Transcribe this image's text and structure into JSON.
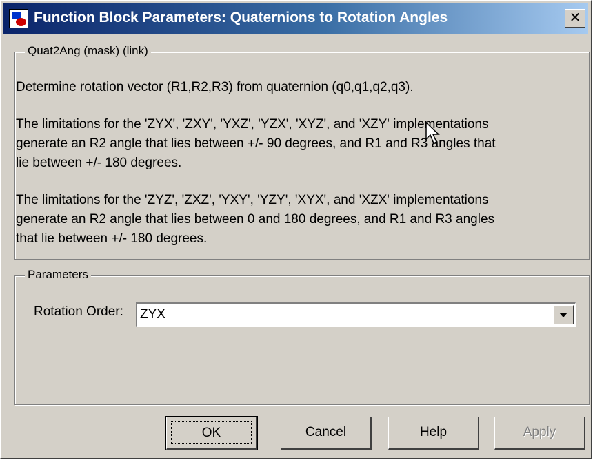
{
  "window": {
    "title": "Function Block Parameters: Quaternions to Rotation Angles",
    "close_label": "✕"
  },
  "mask_group": {
    "legend": "Quat2Ang (mask) (link)",
    "lines": [
      "Determine rotation vector (R1,R2,R3) from quaternion (q0,q1,q2,q3).",
      "The limitations for the 'ZYX', 'ZXY', 'YXZ', 'YZX', 'XYZ', and 'XZY' implementations",
      "generate an R2 angle that lies between +/- 90 degrees, and R1 and R3 angles that",
      "lie between +/- 180 degrees.",
      "The limitations for the 'ZYZ', 'ZXZ', 'YXY', 'YZY', 'XYX', and 'XZX' implementations",
      "generate an R2 angle that lies between 0 and 180 degrees, and R1 and R3 angles",
      "that lie between +/- 180 degrees."
    ]
  },
  "parameters_group": {
    "legend": "Parameters",
    "rotation_order_label": "Rotation Order:",
    "rotation_order_value": "ZYX"
  },
  "buttons": {
    "ok": "OK",
    "cancel": "Cancel",
    "help": "Help",
    "apply": "Apply"
  },
  "colors": {
    "face": "#d4d0c8",
    "title_start": "#0a246a",
    "title_end": "#a6caf0"
  }
}
